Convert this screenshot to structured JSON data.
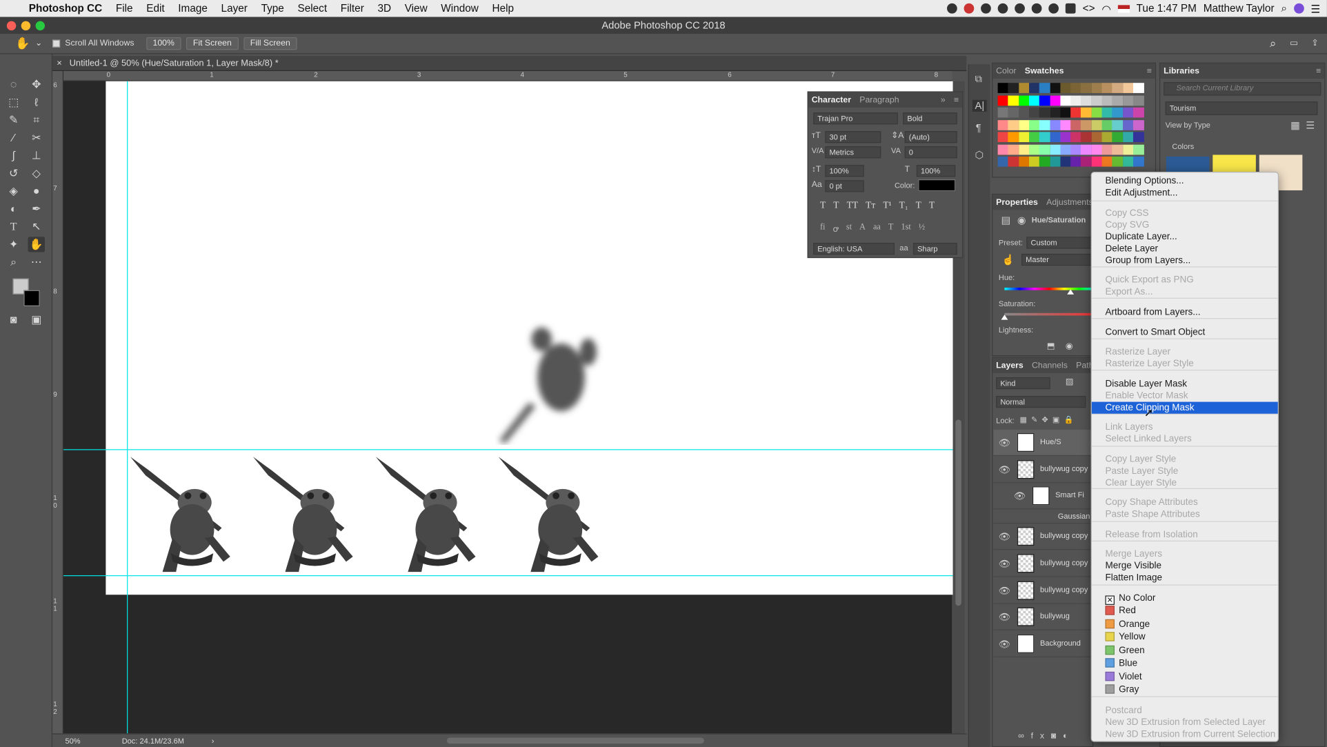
{
  "menubar": {
    "apple": "",
    "items": [
      "Photoshop CC",
      "File",
      "Edit",
      "Image",
      "Layer",
      "Type",
      "Select",
      "Filter",
      "3D",
      "View",
      "Window",
      "Help"
    ],
    "clock": "Tue 1:47 PM",
    "user": "Matthew Taylor"
  },
  "window": {
    "title": "Adobe Photoshop CC 2018"
  },
  "options": {
    "scroll_all": "Scroll All Windows",
    "zoom": "100%",
    "fit": "Fit Screen",
    "fill": "Fill Screen"
  },
  "document": {
    "tab": "Untitled-1 @ 50% (Hue/Saturation 1, Layer Mask/8) *",
    "zoom": "50%",
    "doc_size": "Doc: 24.1M/23.6M",
    "ruler_h": [
      "0",
      "1",
      "2",
      "3",
      "4",
      "5",
      "6",
      "7",
      "8"
    ],
    "ruler_v": [
      "6",
      "7",
      "8",
      "9",
      "10",
      "11",
      "12"
    ]
  },
  "character": {
    "tabs": [
      "Character",
      "Paragraph"
    ],
    "font": "Trajan Pro",
    "style": "Bold",
    "size": "30 pt",
    "leading": "(Auto)",
    "kerning": "Metrics",
    "tracking": "0",
    "vscale": "100%",
    "hscale": "100%",
    "baseline": "0 pt",
    "color_label": "Color:",
    "language": "English: USA",
    "aa_label": "aa",
    "antialias": "Sharp",
    "type_buttons": [
      "T",
      "T",
      "TT",
      "Tт",
      "T¹",
      "T₁",
      "T",
      "T"
    ],
    "ot_buttons": [
      "fi",
      "ꝍ",
      "st",
      "A",
      "aa",
      "T",
      "1st",
      "½"
    ]
  },
  "color_panel": {
    "tabs": [
      "Color",
      "Swatches"
    ]
  },
  "libraries": {
    "title": "Libraries",
    "search_placeholder": "Search Current Library",
    "library": "Tourism",
    "view_by": "View by Type",
    "colors_label": "Colors",
    "swatches": [
      "#2b5a94",
      "#f7e54a",
      "#f1e0c8"
    ]
  },
  "properties": {
    "tabs": [
      "Properties",
      "Adjustments"
    ],
    "title": "Hue/Saturation",
    "preset_label": "Preset:",
    "preset": "Custom",
    "channel": "Master",
    "hue": "Hue:",
    "saturation": "Saturation:",
    "lightness": "Lightness:"
  },
  "layers": {
    "tabs": [
      "Layers",
      "Channels",
      "Paths"
    ],
    "kind": "Kind",
    "blend": "Normal",
    "lock": "Lock:",
    "rows": [
      "Hue/S",
      "bullywug copy",
      "Smart Fi",
      "Gaussian Bl",
      "bullywug copy",
      "bullywug copy",
      "bullywug copy",
      "bullywug",
      "Background"
    ]
  },
  "context_menu": {
    "items": [
      {
        "label": "Blending Options...",
        "disabled": false
      },
      {
        "label": "Edit Adjustment...",
        "disabled": false
      },
      {
        "label": "Copy CSS",
        "disabled": true
      },
      {
        "label": "Copy SVG",
        "disabled": true
      },
      {
        "label": "Duplicate Layer...",
        "disabled": false
      },
      {
        "label": "Delete Layer",
        "disabled": false
      },
      {
        "label": "Group from Layers...",
        "disabled": false
      },
      {
        "label": "Quick Export as PNG",
        "disabled": true
      },
      {
        "label": "Export As...",
        "disabled": true
      },
      {
        "label": "Artboard from Layers...",
        "disabled": false
      },
      {
        "label": "Convert to Smart Object",
        "disabled": false
      },
      {
        "label": "Rasterize Layer",
        "disabled": true
      },
      {
        "label": "Rasterize Layer Style",
        "disabled": true
      },
      {
        "label": "Disable Layer Mask",
        "disabled": false
      },
      {
        "label": "Enable Vector Mask",
        "disabled": true
      },
      {
        "label": "Create Clipping Mask",
        "disabled": false,
        "highlighted": true
      },
      {
        "label": "Link Layers",
        "disabled": true
      },
      {
        "label": "Select Linked Layers",
        "disabled": true
      },
      {
        "label": "Copy Layer Style",
        "disabled": true
      },
      {
        "label": "Paste Layer Style",
        "disabled": true
      },
      {
        "label": "Clear Layer Style",
        "disabled": true
      },
      {
        "label": "Copy Shape Attributes",
        "disabled": true
      },
      {
        "label": "Paste Shape Attributes",
        "disabled": true
      },
      {
        "label": "Release from Isolation",
        "disabled": true
      },
      {
        "label": "Merge Layers",
        "disabled": true
      },
      {
        "label": "Merge Visible",
        "disabled": false
      },
      {
        "label": "Flatten Image",
        "disabled": false
      },
      {
        "label": "No Color",
        "disabled": false
      },
      {
        "label": "Red",
        "disabled": false
      },
      {
        "label": "Orange",
        "disabled": false
      },
      {
        "label": "Yellow",
        "disabled": false
      },
      {
        "label": "Green",
        "disabled": false
      },
      {
        "label": "Blue",
        "disabled": false
      },
      {
        "label": "Violet",
        "disabled": false
      },
      {
        "label": "Gray",
        "disabled": false
      },
      {
        "label": "Postcard",
        "disabled": true
      },
      {
        "label": "New 3D Extrusion from Selected Layer",
        "disabled": true
      },
      {
        "label": "New 3D Extrusion from Current Selection",
        "disabled": true
      }
    ],
    "label_colors": [
      "none",
      "#e05a4f",
      "#ef9b44",
      "#e8d44d",
      "#7cc56a",
      "#5d9fe0",
      "#9a7ad8",
      "#9e9e9e"
    ]
  },
  "colors": {
    "accent": "#1d62d6",
    "guide": "#00e5e5"
  }
}
